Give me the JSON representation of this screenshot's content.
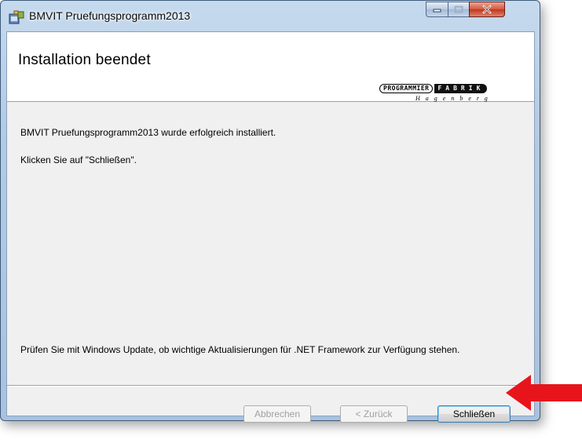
{
  "window": {
    "title": "BMVIT Pruefungsprogramm2013",
    "caption_buttons": [
      "minimize-icon",
      "maximize-icon",
      "close-icon"
    ]
  },
  "banner": {
    "title": "Installation beendet",
    "logo": {
      "line1_left": "PROGRAMMIER",
      "line1_right": "FABRIK",
      "line2": "Hagenberg"
    }
  },
  "content": {
    "message_success": "BMVIT Pruefungsprogramm2013 wurde erfolgreich installiert.",
    "message_instruction": "Klicken Sie auf \"Schließen\".",
    "message_update": "Prüfen Sie mit Windows Update, ob wichtige Aktualisierungen für .NET Framework zur Verfügung stehen."
  },
  "buttons": {
    "cancel_label": "Abbrechen",
    "back_label": "< Zurück",
    "close_label": "Schließen"
  },
  "annotation": {
    "arrow_color": "#e8141c"
  }
}
